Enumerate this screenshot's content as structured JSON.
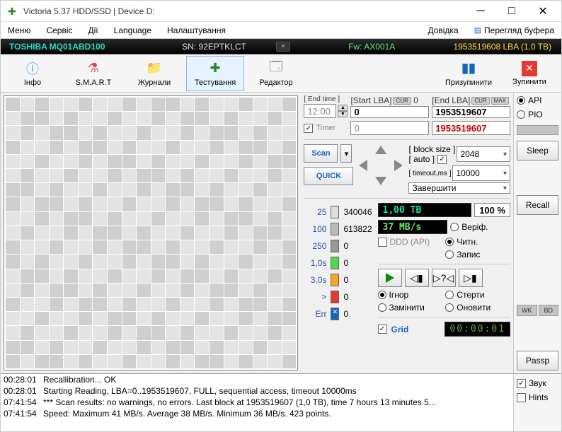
{
  "title": "Victoria 5.37 HDD/SSD | Device D:",
  "menu": {
    "items": [
      "Меню",
      "Сервіс",
      "Дії",
      "Language",
      "Налаштування",
      "Довідка"
    ],
    "buffer": "Перегляд буфера"
  },
  "info": {
    "model": "TOSHIBA MQ01ABD100",
    "serial": "SN: 92EPTKLCT",
    "fw": "Fw: AX001A",
    "lba": "1953519608 LBA (1,0 TB)"
  },
  "toolbar": {
    "info": "Інфо",
    "smart": "S.M.A.R.T",
    "journals": "Журнали",
    "test": "Тестування",
    "editor": "Редактор",
    "pause": "Призупинити",
    "stop": "Зупинити"
  },
  "params": {
    "endtime_label": "[ End time ]",
    "endtime_val": "12:00",
    "timer_label": "Timer",
    "startlba_label": "[Start LBA]",
    "cur": "CUR",
    "startlba_val": "0",
    "endlba_label": "[End LBA]",
    "max": "MAX",
    "endlba_val": "1953519607",
    "start2": "0",
    "end2": "1953519607",
    "scan": "Scan",
    "quick": "QUICK",
    "blocksize_label": "[ block size ]",
    "auto_label": "[ auto ]",
    "timeout_label": "[ timeout,ms ]",
    "blocksize_val": "2048",
    "timeout_val": "10000",
    "action": "Завершити"
  },
  "legend": {
    "rows": [
      {
        "label": "25",
        "color": "#dddddd",
        "count": "340046"
      },
      {
        "label": "100",
        "color": "#bbbbbb",
        "count": "613822"
      },
      {
        "label": "250",
        "color": "#999999",
        "count": "0"
      },
      {
        "label": "1,0s",
        "color": "#4fd94f",
        "count": "0"
      },
      {
        "label": "3,0s",
        "color": "#f5a623",
        "count": "0"
      },
      {
        "label": ">",
        "color": "#e53935",
        "count": "0"
      },
      {
        "label": "Err",
        "color": "#1565c0",
        "count": "0",
        "x": true
      }
    ]
  },
  "stats": {
    "size": "1,00 TB",
    "pct": "100  %",
    "speed": "37 MB/s",
    "ddd": "DDD (API)",
    "verify": "Веріф.",
    "read": "Читн.",
    "write": "Запис",
    "ignore": "Ігнор",
    "erase": "Стерти",
    "remap": "Замінити",
    "refresh": "Оновити",
    "grid": "Grid",
    "timer": "00:00:01"
  },
  "side": {
    "api": "API",
    "pio": "PIO",
    "sleep": "Sleep",
    "recall": "Recall",
    "wk": "WK",
    "bd": "BD",
    "passp": "Passp",
    "sound": "Звук",
    "hints": "Hints"
  },
  "log": [
    {
      "ts": "00:28:01",
      "msg": "Recallibration... OK"
    },
    {
      "ts": "00:28:01",
      "msg": "Starting Reading, LBA=0..1953519607, FULL, sequential access, timeout 10000ms"
    },
    {
      "ts": "07:41:54",
      "msg": "*** Scan results: no warnings, no errors. Last block at 1953519607 (1,0 TB), time 7 hours 13 minutes 5..."
    },
    {
      "ts": "07:41:54",
      "msg": "Speed: Maximum 41 MB/s. Average 38 MB/s. Minimum 36 MB/s. 423 points."
    }
  ]
}
